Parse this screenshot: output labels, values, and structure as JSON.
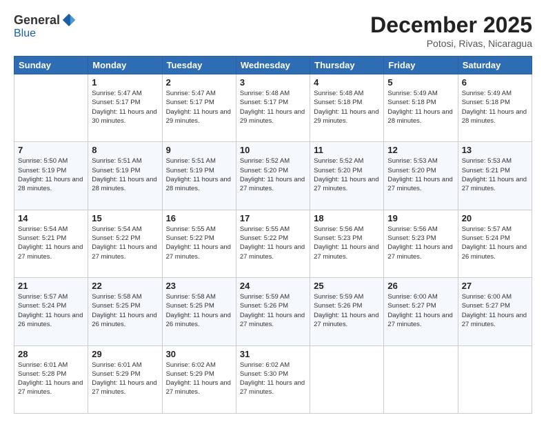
{
  "logo": {
    "general": "General",
    "blue": "Blue"
  },
  "header": {
    "month": "December 2025",
    "location": "Potosi, Rivas, Nicaragua"
  },
  "weekdays": [
    "Sunday",
    "Monday",
    "Tuesday",
    "Wednesday",
    "Thursday",
    "Friday",
    "Saturday"
  ],
  "weeks": [
    [
      {
        "day": null
      },
      {
        "day": "1",
        "sunrise": "Sunrise: 5:47 AM",
        "sunset": "Sunset: 5:17 PM",
        "daylight": "Daylight: 11 hours and 30 minutes."
      },
      {
        "day": "2",
        "sunrise": "Sunrise: 5:47 AM",
        "sunset": "Sunset: 5:17 PM",
        "daylight": "Daylight: 11 hours and 29 minutes."
      },
      {
        "day": "3",
        "sunrise": "Sunrise: 5:48 AM",
        "sunset": "Sunset: 5:17 PM",
        "daylight": "Daylight: 11 hours and 29 minutes."
      },
      {
        "day": "4",
        "sunrise": "Sunrise: 5:48 AM",
        "sunset": "Sunset: 5:18 PM",
        "daylight": "Daylight: 11 hours and 29 minutes."
      },
      {
        "day": "5",
        "sunrise": "Sunrise: 5:49 AM",
        "sunset": "Sunset: 5:18 PM",
        "daylight": "Daylight: 11 hours and 28 minutes."
      },
      {
        "day": "6",
        "sunrise": "Sunrise: 5:49 AM",
        "sunset": "Sunset: 5:18 PM",
        "daylight": "Daylight: 11 hours and 28 minutes."
      }
    ],
    [
      {
        "day": "7",
        "sunrise": "Sunrise: 5:50 AM",
        "sunset": "Sunset: 5:19 PM",
        "daylight": "Daylight: 11 hours and 28 minutes."
      },
      {
        "day": "8",
        "sunrise": "Sunrise: 5:51 AM",
        "sunset": "Sunset: 5:19 PM",
        "daylight": "Daylight: 11 hours and 28 minutes."
      },
      {
        "day": "9",
        "sunrise": "Sunrise: 5:51 AM",
        "sunset": "Sunset: 5:19 PM",
        "daylight": "Daylight: 11 hours and 28 minutes."
      },
      {
        "day": "10",
        "sunrise": "Sunrise: 5:52 AM",
        "sunset": "Sunset: 5:20 PM",
        "daylight": "Daylight: 11 hours and 27 minutes."
      },
      {
        "day": "11",
        "sunrise": "Sunrise: 5:52 AM",
        "sunset": "Sunset: 5:20 PM",
        "daylight": "Daylight: 11 hours and 27 minutes."
      },
      {
        "day": "12",
        "sunrise": "Sunrise: 5:53 AM",
        "sunset": "Sunset: 5:20 PM",
        "daylight": "Daylight: 11 hours and 27 minutes."
      },
      {
        "day": "13",
        "sunrise": "Sunrise: 5:53 AM",
        "sunset": "Sunset: 5:21 PM",
        "daylight": "Daylight: 11 hours and 27 minutes."
      }
    ],
    [
      {
        "day": "14",
        "sunrise": "Sunrise: 5:54 AM",
        "sunset": "Sunset: 5:21 PM",
        "daylight": "Daylight: 11 hours and 27 minutes."
      },
      {
        "day": "15",
        "sunrise": "Sunrise: 5:54 AM",
        "sunset": "Sunset: 5:22 PM",
        "daylight": "Daylight: 11 hours and 27 minutes."
      },
      {
        "day": "16",
        "sunrise": "Sunrise: 5:55 AM",
        "sunset": "Sunset: 5:22 PM",
        "daylight": "Daylight: 11 hours and 27 minutes."
      },
      {
        "day": "17",
        "sunrise": "Sunrise: 5:55 AM",
        "sunset": "Sunset: 5:22 PM",
        "daylight": "Daylight: 11 hours and 27 minutes."
      },
      {
        "day": "18",
        "sunrise": "Sunrise: 5:56 AM",
        "sunset": "Sunset: 5:23 PM",
        "daylight": "Daylight: 11 hours and 27 minutes."
      },
      {
        "day": "19",
        "sunrise": "Sunrise: 5:56 AM",
        "sunset": "Sunset: 5:23 PM",
        "daylight": "Daylight: 11 hours and 27 minutes."
      },
      {
        "day": "20",
        "sunrise": "Sunrise: 5:57 AM",
        "sunset": "Sunset: 5:24 PM",
        "daylight": "Daylight: 11 hours and 26 minutes."
      }
    ],
    [
      {
        "day": "21",
        "sunrise": "Sunrise: 5:57 AM",
        "sunset": "Sunset: 5:24 PM",
        "daylight": "Daylight: 11 hours and 26 minutes."
      },
      {
        "day": "22",
        "sunrise": "Sunrise: 5:58 AM",
        "sunset": "Sunset: 5:25 PM",
        "daylight": "Daylight: 11 hours and 26 minutes."
      },
      {
        "day": "23",
        "sunrise": "Sunrise: 5:58 AM",
        "sunset": "Sunset: 5:25 PM",
        "daylight": "Daylight: 11 hours and 26 minutes."
      },
      {
        "day": "24",
        "sunrise": "Sunrise: 5:59 AM",
        "sunset": "Sunset: 5:26 PM",
        "daylight": "Daylight: 11 hours and 27 minutes."
      },
      {
        "day": "25",
        "sunrise": "Sunrise: 5:59 AM",
        "sunset": "Sunset: 5:26 PM",
        "daylight": "Daylight: 11 hours and 27 minutes."
      },
      {
        "day": "26",
        "sunrise": "Sunrise: 6:00 AM",
        "sunset": "Sunset: 5:27 PM",
        "daylight": "Daylight: 11 hours and 27 minutes."
      },
      {
        "day": "27",
        "sunrise": "Sunrise: 6:00 AM",
        "sunset": "Sunset: 5:27 PM",
        "daylight": "Daylight: 11 hours and 27 minutes."
      }
    ],
    [
      {
        "day": "28",
        "sunrise": "Sunrise: 6:01 AM",
        "sunset": "Sunset: 5:28 PM",
        "daylight": "Daylight: 11 hours and 27 minutes."
      },
      {
        "day": "29",
        "sunrise": "Sunrise: 6:01 AM",
        "sunset": "Sunset: 5:29 PM",
        "daylight": "Daylight: 11 hours and 27 minutes."
      },
      {
        "day": "30",
        "sunrise": "Sunrise: 6:02 AM",
        "sunset": "Sunset: 5:29 PM",
        "daylight": "Daylight: 11 hours and 27 minutes."
      },
      {
        "day": "31",
        "sunrise": "Sunrise: 6:02 AM",
        "sunset": "Sunset: 5:30 PM",
        "daylight": "Daylight: 11 hours and 27 minutes."
      },
      {
        "day": null
      },
      {
        "day": null
      },
      {
        "day": null
      }
    ]
  ]
}
